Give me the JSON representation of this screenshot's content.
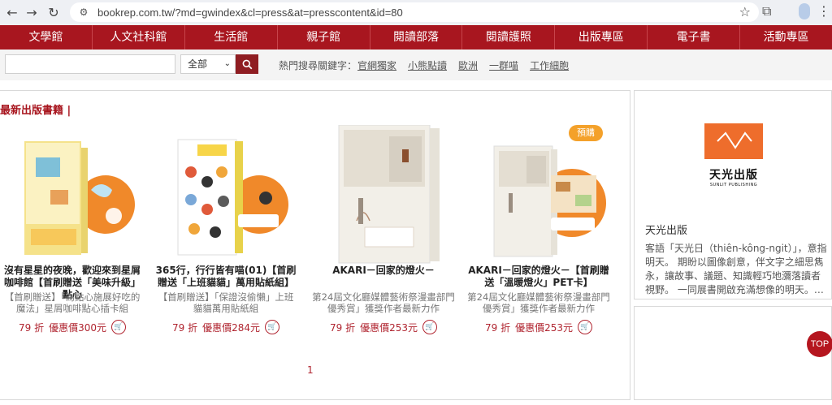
{
  "browser": {
    "url": "bookrep.com.tw/?md=gwindex&cl=press&at=presscontent&id=80"
  },
  "nav": {
    "items": [
      "文學館",
      "人文社科館",
      "生活館",
      "親子館",
      "閱讀部落",
      "閱讀護照",
      "出版專區",
      "電子書",
      "活動專區"
    ]
  },
  "search": {
    "input_value": "",
    "select_value": "全部",
    "hot_label": "熱門搜尋關鍵字：",
    "hot_keywords": [
      "官網獨家",
      "小熊點讀",
      "歐洲",
      "一群喵",
      "工作細胞"
    ]
  },
  "section": {
    "title": "最新出版書籍 |"
  },
  "books": [
    {
      "title": "沒有星星的夜晚，歡迎來到星屑咖啡館【首刷贈送「美味升級」點心",
      "desc": "【首刷贈送】「為點心施展好吃的魔法」星屑咖啡點心插卡組",
      "discount": "79 折",
      "price": "優惠價300元",
      "badge": ""
    },
    {
      "title": "365行，行行皆有喵(01)【首刷贈送「上班貓貓」萬用貼紙組】",
      "desc": "【首刷贈送】「保證沒偷懶」上班貓貓萬用貼紙組",
      "discount": "79 折",
      "price": "優惠價284元",
      "badge": ""
    },
    {
      "title": "AKARI－回家的燈火－",
      "desc": "第24屆文化廳媒體藝術祭漫畫部門優秀賞」獲獎作者最新力作",
      "discount": "79 折",
      "price": "優惠價253元",
      "badge": ""
    },
    {
      "title": "AKARI－回家的燈火－【首刷贈送「溫暖燈火」PET卡】",
      "desc": "第24屆文化廳媒體藝術祭漫畫部門優秀賞」獲獎作者最新力作",
      "discount": "79 折",
      "price": "優惠價253元",
      "badge": "預購"
    }
  ],
  "pager": {
    "current": "1"
  },
  "sidebar": {
    "logo_text_cn": "天光出版",
    "logo_text_en": "SUNLIT PUBLISHING",
    "publisher_name": "天光出版",
    "publisher_desc": "客語「天光日（thiên-kông-ngit）」，意指明天。 期盼以圖像創意，伴文字之細思雋永，讓故事、議題、知識輕巧地瀰落讀者視野。 一同展書開啟充滿想像的明天。…"
  },
  "top_button": "TOP",
  "colors": {
    "brand_red": "#a8161f",
    "price_red": "#b02530",
    "orange": "#f0892a"
  }
}
